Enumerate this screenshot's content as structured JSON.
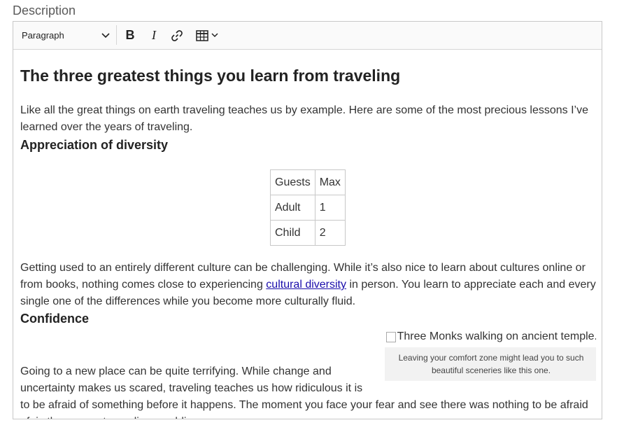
{
  "field_label": "Description",
  "toolbar": {
    "paragraph_label": "Paragraph",
    "bold_label": "B",
    "italic_label": "I"
  },
  "content": {
    "heading": "The three greatest things you learn from traveling",
    "intro": "Like all the great things on earth traveling teaches us by example. Here are some of the most precious lessons I’ve learned over the years of traveling.",
    "section1_heading": "Appreciation of diversity",
    "table": {
      "header": [
        "Guests",
        "Max"
      ],
      "rows": [
        [
          "Adult",
          "1"
        ],
        [
          "Child",
          "2"
        ]
      ]
    },
    "paragraph2_before": "Getting used to an entirely different culture can be challenging. While it’s also nice to learn about cultures online or from books, nothing comes close to experiencing ",
    "paragraph2_link": "cultural diversity",
    "paragraph2_after": " in person. You learn to appreciate each and every single one of the differences while you become more culturally fluid.",
    "section2_heading": "Confidence",
    "image_alt": "Three Monks walking on ancient temple.",
    "image_caption": "Leaving your comfort zone might lead you to such beautiful sceneries like this one.",
    "paragraph3": "Going to a new place can be quite terrifying. While change and uncertainty makes us scared, traveling teaches us how ridiculous it is to be afraid of something before it happens. The moment you face your fear and see there was nothing to be afraid of, is the moment you discover bliss."
  },
  "icons": {
    "dropdown": "chevron-down-icon",
    "link": "link-icon",
    "table": "table-icon",
    "broken_image": "broken-image-icon"
  },
  "colors": {
    "link": "#1a0dab",
    "caption_bg": "#f2f2f2",
    "toolbar_bg": "#fafafa",
    "border": "#c8c8c8"
  }
}
